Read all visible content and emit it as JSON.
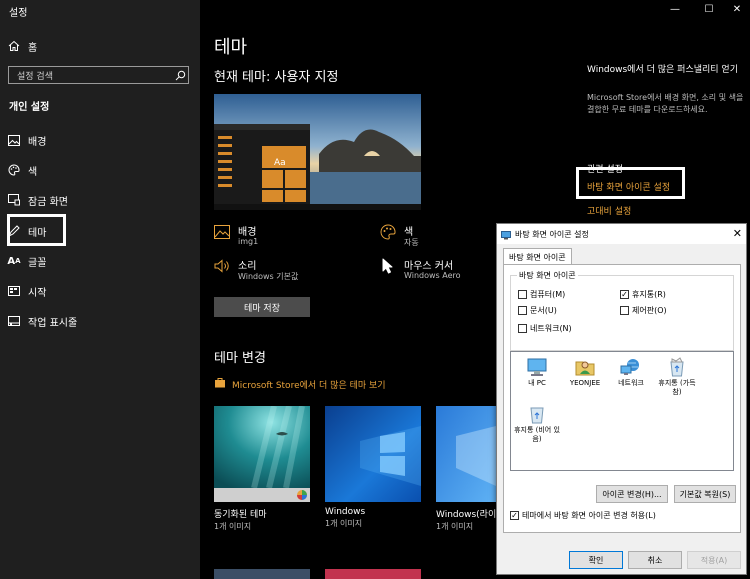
{
  "app": {
    "title": "설정"
  },
  "caption": {
    "minimize": "—",
    "maximize": "☐",
    "close": "✕"
  },
  "sidebar": {
    "home": "홈",
    "search_placeholder": "설정 검색",
    "section": "개인 설정",
    "items": [
      {
        "label": "배경",
        "icon": "image-icon"
      },
      {
        "label": "색",
        "icon": "palette-icon"
      },
      {
        "label": "잠금 화면",
        "icon": "lock-screen-icon"
      },
      {
        "label": "테마",
        "icon": "brush-icon",
        "selected": true
      },
      {
        "label": "글꼴",
        "icon": "font-icon"
      },
      {
        "label": "시작",
        "icon": "start-icon"
      },
      {
        "label": "작업 표시줄",
        "icon": "taskbar-icon"
      }
    ]
  },
  "main": {
    "title": "테마",
    "current_theme": "현재 테마: 사용자 지정",
    "preview_tile": "Aa",
    "attributes": [
      {
        "title": "배경",
        "value": "img1",
        "icon": "image-icon"
      },
      {
        "title": "색",
        "value": "자동",
        "icon": "palette-icon"
      },
      {
        "title": "소리",
        "value": "Windows 기본값",
        "icon": "speaker-icon"
      },
      {
        "title": "마우스 커서",
        "value": "Windows Aero",
        "icon": "cursor-icon"
      }
    ],
    "save_button": "테마 저장",
    "change_heading": "테마 변경",
    "store_link": "Microsoft Store에서 더 많은 테마 보기",
    "themes": [
      {
        "name": "동기화된 테마",
        "count": "1개 이미지"
      },
      {
        "name": "Windows",
        "count": "1개 이미지"
      },
      {
        "name": "Windows(라이...",
        "count": "1개 이미지"
      }
    ],
    "right": {
      "title": "Windows에서 더 많은 퍼스낼리티 얻기",
      "description": "Microsoft Store에서 배경 화면, 소리 및 색을 결합한 무료 테마를 다운로드하세요.",
      "related_title": "관련 설정",
      "related_links": [
        "바탕 화면 아이콘 설정",
        "고대비 설정"
      ]
    }
  },
  "dialog": {
    "title": "바탕 화면 아이콘 설정",
    "close": "✕",
    "tab": "바탕 화면 아이콘",
    "group_label": "바탕 화면 아이콘",
    "checkboxes": [
      {
        "label": "컴퓨터(M)",
        "checked": false
      },
      {
        "label": "휴지통(R)",
        "checked": true
      },
      {
        "label": "문서(U)",
        "checked": false
      },
      {
        "label": "제어판(O)",
        "checked": false
      },
      {
        "label": "네트워크(N)",
        "checked": false
      }
    ],
    "icons": [
      {
        "label": "내 PC",
        "icon": "computer-icon"
      },
      {
        "label": "YEONJEE",
        "icon": "user-folder-icon"
      },
      {
        "label": "네트워크",
        "icon": "network-icon"
      },
      {
        "label": "휴지통 (가득 참)",
        "icon": "recycle-bin-full-icon"
      },
      {
        "label": "휴지통 (비어 있음)",
        "icon": "recycle-bin-empty-icon"
      }
    ],
    "change_icon_button": "아이콘 변경(H)...",
    "restore_button": "기본값 복원(S)",
    "allow_themes": {
      "label": "테마에서 바탕 화면 아이콘 변경 허용(L)",
      "checked": true
    },
    "ok": "확인",
    "cancel": "취소",
    "apply": "적용(A)"
  },
  "colors": {
    "accent": "#e8a33c",
    "sidebar": "#1f1f1f",
    "background": "#000000"
  }
}
